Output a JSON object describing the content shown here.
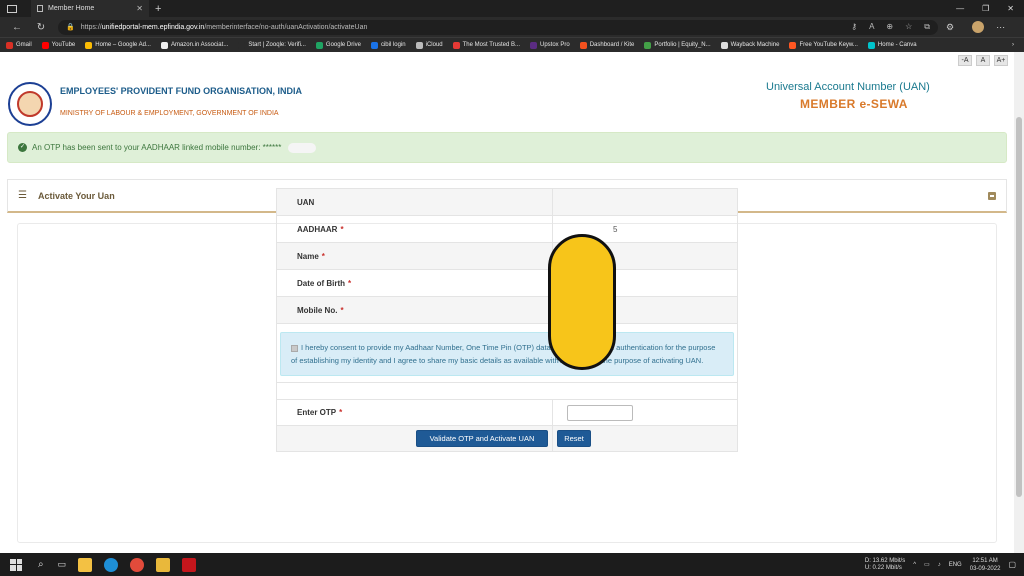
{
  "browser": {
    "tab_title": "Member Home",
    "url_host": "unifiedportal-mem.epfindia.gov.in",
    "url_path": "/memberinterface/no-auth/uanActivation/activateUan",
    "url_scheme": "https://",
    "bookmarks": [
      {
        "label": "Gmail",
        "color": "#d93025"
      },
      {
        "label": "YouTube",
        "color": "#ff0000"
      },
      {
        "label": "Home – Google Ad...",
        "color": "#fbbc04"
      },
      {
        "label": "Amazon.in Associat...",
        "color": "#f0f0f0"
      },
      {
        "label": "Start | Zooqle: Verifi...",
        "color": "#2b2b2b"
      },
      {
        "label": "Google Drive",
        "color": "#1fa463"
      },
      {
        "label": "cibil login",
        "color": "#1a73e8"
      },
      {
        "label": "iCloud",
        "color": "#bbbbbb"
      },
      {
        "label": "The Most Trusted B...",
        "color": "#e53935"
      },
      {
        "label": "Upstox Pro",
        "color": "#5b2c83"
      },
      {
        "label": "Dashboard / Kite",
        "color": "#f4511e"
      },
      {
        "label": "Portfolio | Equity_N...",
        "color": "#43a047"
      },
      {
        "label": "Wayback Machine",
        "color": "#dddddd"
      },
      {
        "label": "Free YouTube Keyw...",
        "color": "#ff5722"
      },
      {
        "label": "Home - Canva",
        "color": "#00c4cc"
      }
    ]
  },
  "page": {
    "font_controls": [
      "-A",
      "A",
      "A+"
    ],
    "org_name": "EMPLOYEES' PROVIDENT FUND ORGANISATION, INDIA",
    "org_sub": "MINISTRY OF LABOUR & EMPLOYMENT, GOVERNMENT OF INDIA",
    "uan_title": "Universal Account Number (UAN)",
    "esewa": "MEMBER e-SEWA",
    "alert": "An OTP has been sent to your AADHAAR linked mobile number: ******",
    "panel_title": "Activate Your Uan"
  },
  "form": {
    "fields": [
      {
        "label": "UAN",
        "required": false
      },
      {
        "label": "AADHAAR",
        "required": true
      },
      {
        "label": "Name",
        "required": true
      },
      {
        "label": "Date of Birth",
        "required": true
      },
      {
        "label": "Mobile No.",
        "required": true
      }
    ],
    "req_mark": "*",
    "aadhaar_peek": "5",
    "consent": "I hereby consent to provide my Aadhaar Number, One Time Pin (OTP) data for Aadhaar based authentication for the purpose of establishing my identity and I agree to share my basic details as available with Aadhaar for the purpose of activating UAN.",
    "otp_label": "Enter OTP",
    "otp_value": "",
    "validate_label": "Validate OTP and Activate UAN",
    "reset_label": "Reset"
  },
  "taskbar": {
    "down": "D:",
    "up": "U:",
    "down_speed": "13.62 Mbit/s",
    "up_speed": "0.22 Mbit/s",
    "lang": "ENG",
    "time": "12:51 AM",
    "date": "03-09-2022"
  }
}
